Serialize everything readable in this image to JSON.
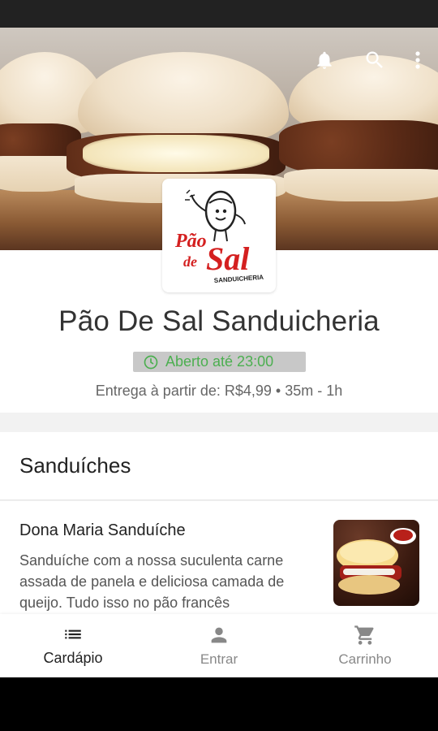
{
  "store": {
    "name": "Pão De Sal Sanduicheria",
    "status": "Aberto até 23:00",
    "delivery_info": "Entrega à partir de: R$4,99 • 35m - 1h",
    "logo": {
      "line1": "Pão",
      "line2": "de",
      "line3": "Sal",
      "tagline": "SANDUICHERIA"
    }
  },
  "header_icons": [
    "bell-icon",
    "search-icon",
    "more-vert-icon"
  ],
  "menu": {
    "section_title": "Sanduíches",
    "items": [
      {
        "name": "Dona Maria Sanduíche",
        "description": "Sanduíche com a nossa suculenta carne assada de panela e deliciosa camada de queijo. Tudo isso no pão francês"
      }
    ]
  },
  "bottom_nav": [
    {
      "label": "Cardápio",
      "icon": "list-icon",
      "active": true
    },
    {
      "label": "Entrar",
      "icon": "person-icon",
      "active": false
    },
    {
      "label": "Carrinho",
      "icon": "cart-icon",
      "active": false
    }
  ],
  "colors": {
    "open_status": "#4caf50",
    "logo_red": "#d42020"
  }
}
